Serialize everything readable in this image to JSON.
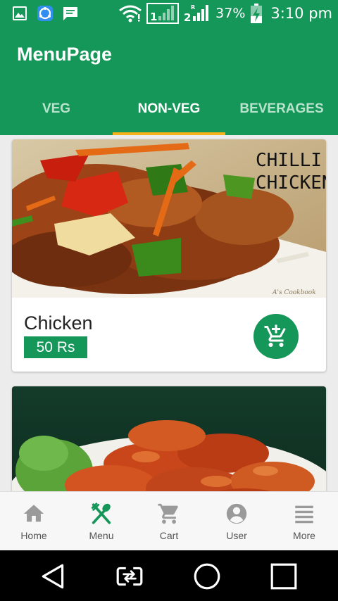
{
  "status_bar": {
    "battery_text": "37%",
    "time": "3:10 pm",
    "sim1_label": "1",
    "sim2_label": "2",
    "roaming_label": "R",
    "icons": [
      "gallery-icon",
      "sync-icon",
      "message-icon",
      "wifi-icon",
      "signal-sim1-icon",
      "signal-sim2-icon",
      "battery-charging-icon"
    ]
  },
  "app_bar": {
    "title": "MenuPage"
  },
  "tabs": [
    {
      "label": "VEG",
      "active": false
    },
    {
      "label": "NON-VEG",
      "active": true
    },
    {
      "label": "BEVERAGES",
      "active": false
    }
  ],
  "items": [
    {
      "name": "Chicken",
      "price": "50 Rs",
      "image_text_line1": "CHILLI",
      "image_text_line2": "CHICKEN",
      "image_signature": "A's Cookbook"
    },
    {
      "name": "",
      "price": ""
    }
  ],
  "bottom_nav": [
    {
      "label": "Home",
      "icon": "home-icon",
      "active": false
    },
    {
      "label": "Menu",
      "icon": "fork-spoon-icon",
      "active": true
    },
    {
      "label": "Cart",
      "icon": "cart-icon",
      "active": false
    },
    {
      "label": "User",
      "icon": "user-icon",
      "active": false
    },
    {
      "label": "More",
      "icon": "menu-lines-icon",
      "active": false
    }
  ],
  "colors": {
    "primary": "#16975a",
    "tab_indicator": "#f5b21a",
    "inactive_tab": "#b9e3cc",
    "nav_inactive": "#9a9a9a"
  }
}
